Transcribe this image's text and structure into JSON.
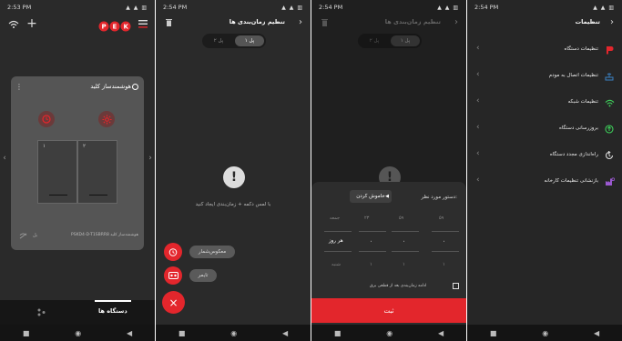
{
  "colors": {
    "accent": "#e3262c",
    "dark_bg": "#2a2a2a",
    "card_bg": "#555555",
    "green_wifi": "#3ecf5a"
  },
  "phone1": {
    "status_time": "2:53 PM",
    "status_icons": "▲ ▲ ▥",
    "brand": "PEK",
    "card_title": "هوشمندساز کلید",
    "switches": [
      "۱",
      "۲"
    ],
    "footer_brand": "هوشمندساز کلید",
    "footer_code": "PSKD4-D-T1SBRR8",
    "footer_state": "بل",
    "tab_devices": "دستگاه ها"
  },
  "phone2": {
    "status_time": "2:54 PM",
    "status_icons": "▲ ▲ ▥",
    "title": "تنظیم زمان‌بندی ها",
    "tabs": [
      "پل ۱",
      "پل ۲"
    ],
    "empty_text": "با لمس دکمه + زمان‌بندی ایجاد کنید",
    "fab_reverse_label": "معکوس‌شمار",
    "fab_timer_label": "تایمر",
    "fab_close_symbol": "×"
  },
  "phone3": {
    "status_time": "2:54 PM",
    "status_icons": "▲ ▲ ▥",
    "title": "تنظیم زمان‌بندی ها",
    "tabs": [
      "پل ۱",
      "پل ۲"
    ],
    "command_label": "دستور مورد نظر:",
    "command_value": "خاموش کردن",
    "picker_row1": [
      "۵۹",
      "۵۹",
      "۲۳",
      "جمعه"
    ],
    "picker_row2": [
      "۰",
      "۰",
      "۰",
      "هر روز"
    ],
    "picker_row3": [
      "۱",
      "۱",
      "۱",
      "شنبه"
    ],
    "checkbox_label": "ادامه زمان‌بندی بعد از قطعی برق",
    "submit_label": "ثبت"
  },
  "phone4": {
    "status_time": "2:54 PM",
    "status_icons": "▲ ▲ ▥",
    "title": "تنظیمات",
    "items": [
      {
        "label": "تنظیمات دستگاه",
        "icon": "pek-logo-icon"
      },
      {
        "label": "تنظیمات اتصال به مودم",
        "icon": "router-icon"
      },
      {
        "label": "تنظیمات شبکه",
        "icon": "wifi-icon"
      },
      {
        "label": "بروزرسانی دستگاه",
        "icon": "update-icon"
      },
      {
        "label": "راه‌اندازی مجدد دستگاه",
        "icon": "restart-icon"
      },
      {
        "label": "بازنشانی تنظیمات کارخانه",
        "icon": "factory-reset-icon"
      }
    ]
  },
  "nav": {
    "square": "■",
    "circle": "◉",
    "back": "◀"
  }
}
